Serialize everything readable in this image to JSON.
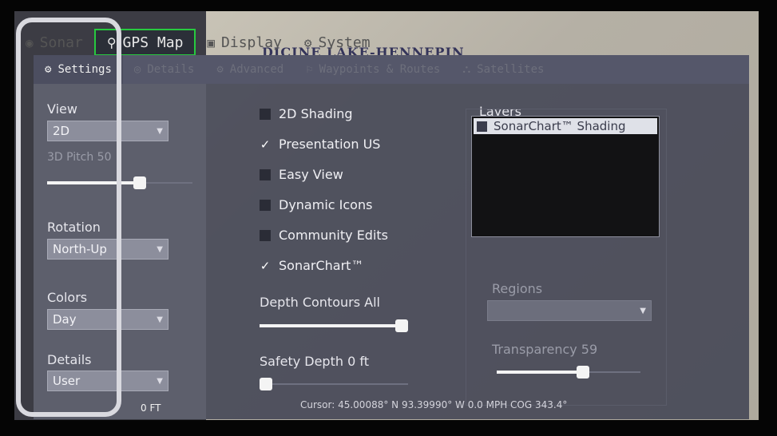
{
  "top_tabs": [
    {
      "label": "Sonar",
      "icon": "sonar-icon",
      "glyph": "◉",
      "active": false
    },
    {
      "label": "GPS Map",
      "icon": "gps-map-icon",
      "glyph": "⚲",
      "active": true
    },
    {
      "label": "Display",
      "icon": "display-icon",
      "glyph": "▣",
      "active": false
    },
    {
      "label": "System",
      "icon": "system-gear-icon",
      "glyph": "⚙",
      "active": false
    }
  ],
  "map_label": "DICINE LAKE-HENNEPIN",
  "sub_tabs": [
    {
      "label": "Settings",
      "icon": "settings-gear-icon",
      "glyph": "⚙",
      "active": true
    },
    {
      "label": "Details",
      "icon": "details-icon",
      "glyph": "◎",
      "active": false
    },
    {
      "label": "Advanced",
      "icon": "advanced-gear-icon",
      "glyph": "⚙",
      "active": false
    },
    {
      "label": "Waypoints & Routes",
      "icon": "waypoints-icon",
      "glyph": "⚐",
      "active": false
    },
    {
      "label": "Satellites",
      "icon": "satellites-icon",
      "glyph": "⛬",
      "active": false
    }
  ],
  "left_column": {
    "view_label": "View",
    "view_value": "2D",
    "pitch_label": "3D Pitch 50",
    "pitch_value": 50,
    "rotation_label": "Rotation",
    "rotation_value": "North-Up",
    "colors_label": "Colors",
    "colors_value": "Day",
    "details_label": "Details",
    "details_value": "User"
  },
  "checkboxes": [
    {
      "label": "2D Shading",
      "checked": false
    },
    {
      "label": "Presentation US",
      "checked": true
    },
    {
      "label": "Easy View",
      "checked": false
    },
    {
      "label": "Dynamic Icons",
      "checked": false
    },
    {
      "label": "Community Edits",
      "checked": false
    },
    {
      "label": "SonarChart™",
      "checked": true
    }
  ],
  "depth_contours": {
    "label": "Depth Contours All",
    "value": 1.0
  },
  "safety_depth": {
    "label": "Safety Depth 0 ft",
    "value": 0.0
  },
  "layers": {
    "title": "Layers",
    "items": [
      {
        "label": "SonarChart™ Shading",
        "checked": false
      }
    ]
  },
  "regions": {
    "label": "Regions",
    "value": ""
  },
  "transparency": {
    "label": "Transparency 59",
    "value": 59
  },
  "status": {
    "depth": "0 FT",
    "cursor": "Cursor: 45.00088° N  93.39990° W  0.0 MPH  COG 343.4°"
  },
  "colors": {
    "active_tab_border": "#27c93f",
    "panel_bg": "#484a58"
  }
}
